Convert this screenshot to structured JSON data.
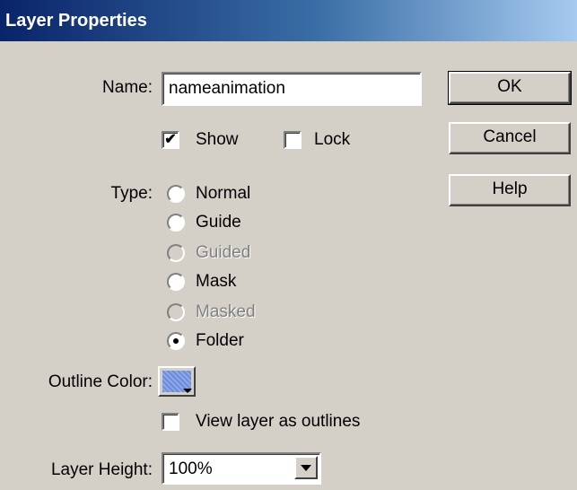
{
  "window": {
    "title": "Layer Properties"
  },
  "name": {
    "label": "Name:",
    "value": "nameanimation"
  },
  "show": {
    "label": "Show",
    "checked": true
  },
  "lock": {
    "label": "Lock",
    "checked": false
  },
  "type": {
    "label": "Type:",
    "options": [
      {
        "label": "Normal",
        "selected": false,
        "disabled": false
      },
      {
        "label": "Guide",
        "selected": false,
        "disabled": false
      },
      {
        "label": "Guided",
        "selected": false,
        "disabled": true
      },
      {
        "label": "Mask",
        "selected": false,
        "disabled": false
      },
      {
        "label": "Masked",
        "selected": false,
        "disabled": true
      },
      {
        "label": "Folder",
        "selected": true,
        "disabled": false
      }
    ]
  },
  "outline": {
    "label": "Outline Color:",
    "color": "#6b8cdc"
  },
  "view_outlines": {
    "label": "View layer as outlines",
    "checked": false
  },
  "layer_height": {
    "label": "Layer Height:",
    "value": "100%"
  },
  "buttons": {
    "ok": "OK",
    "cancel": "Cancel",
    "help": "Help"
  },
  "colors": {
    "title_start": "#0a246a",
    "title_end": "#a6caf0",
    "face": "#d4d0c8"
  }
}
